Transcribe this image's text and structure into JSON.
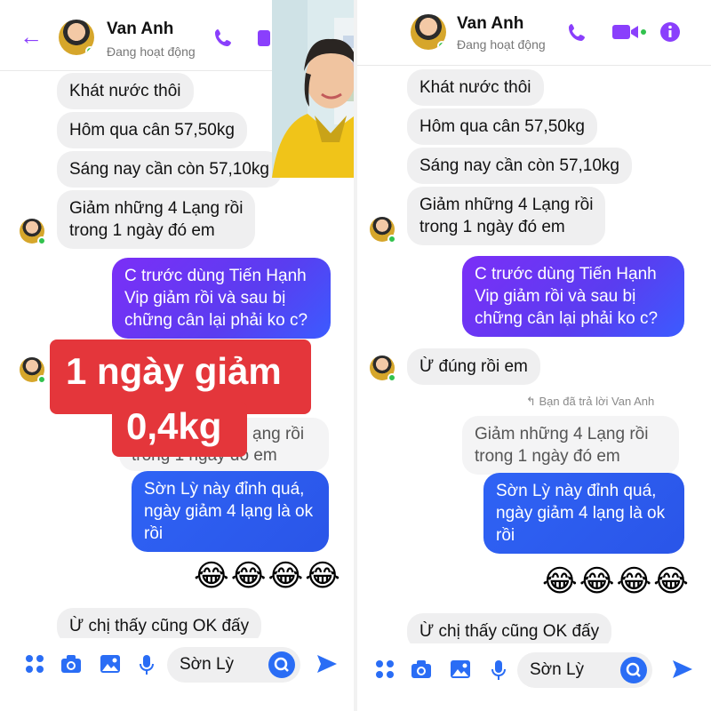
{
  "left": {
    "contact_name": "Van Anh",
    "contact_status": "Đang hoạt động",
    "messages": [
      {
        "text": "Khát nước thôi"
      },
      {
        "text": "Hôm qua cân 57,50kg"
      },
      {
        "text": "Sáng nay cần còn 57,10kg"
      },
      {
        "text": "Giảm những 4 Lạng rồi\ntrong 1 ngày đó em"
      }
    ],
    "sent_question": "C trước dùng Tiến Hạnh\nVip giảm rồi và sau bị\nchững cân lại phải ko c?",
    "partial_quote_right": "ạng rồi",
    "partial_quote_bottom": "trong 1 ngày đó em",
    "sent_praise": "Sờn Lỳ này đỉnh quá,\nngày giảm 4 lạng là ok\nrồi",
    "emojis": "😂😂😂😂",
    "last_message": "Ừ chị thấy cũng OK đấy",
    "composer_text": "Sờn Lỳ"
  },
  "overlay": {
    "line1": "1 ngày giảm",
    "line2": "0,4kg"
  },
  "right": {
    "contact_name": "Van Anh",
    "contact_status": "Đang hoạt động",
    "messages": [
      {
        "text": "Khát nước thôi"
      },
      {
        "text": "Hôm qua cân 57,50kg"
      },
      {
        "text": "Sáng nay cần còn 57,10kg"
      },
      {
        "text": "Giảm những 4 Lạng rồi\ntrong 1 ngày đó em"
      }
    ],
    "sent_question": "C trước dùng Tiến Hạnh\nVip giảm rồi và sau bị\nchững cân lại phải ko c?",
    "reply_confirm": "Ừ đúng rồi em",
    "replied_label": "↰ Bạn đã trả lời Van Anh",
    "quoted": "Giảm những 4 Lạng rồi\ntrong 1 ngày đó em",
    "sent_praise": "Sờn Lỳ này đỉnh quá,\nngày giảm 4 lạng là ok\nrồi",
    "emojis": "😂😂😂😂",
    "last_message": "Ừ chị thấy cũng OK đấy",
    "composer_text": "Sờn Lỳ"
  },
  "colors": {
    "accent": "#8a3ffc",
    "online": "#31c24d",
    "overlay_red": "#e4363b",
    "send_blue": "#2a6df5"
  },
  "icons": [
    "back-arrow-icon",
    "phone-icon",
    "video-icon",
    "info-icon",
    "menu-dots-icon",
    "camera-icon",
    "image-icon",
    "mic-icon",
    "search-icon",
    "send-icon"
  ]
}
